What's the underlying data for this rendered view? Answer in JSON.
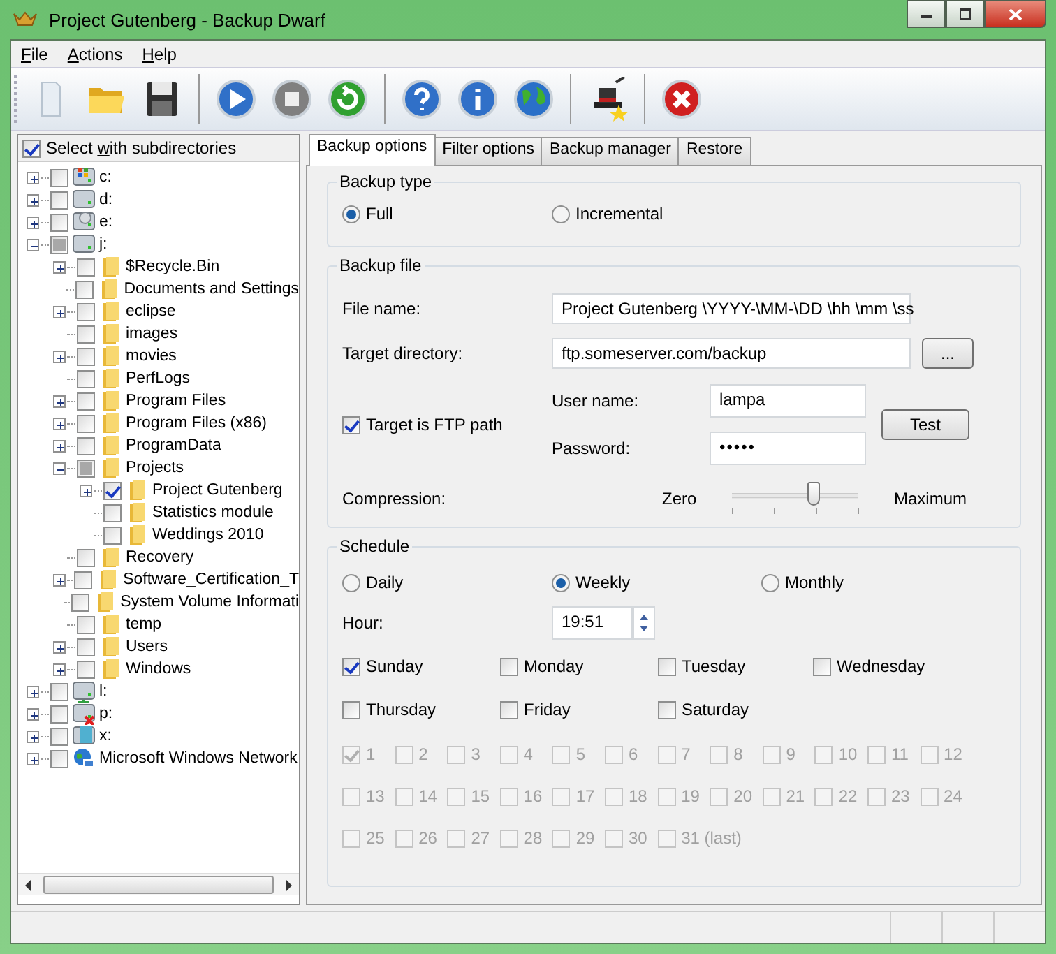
{
  "window": {
    "title": "Project Gutenberg - Backup Dwarf"
  },
  "menu": [
    {
      "label": "File"
    },
    {
      "label": "Actions"
    },
    {
      "label": "Help"
    }
  ],
  "tree": {
    "select_with_subdirectories": {
      "label": "Select with subdirectories",
      "checked": true
    },
    "items": [
      {
        "label": "c:",
        "kind": "windows-drive",
        "checked": false,
        "partial": false,
        "expanded": false
      },
      {
        "label": "d:",
        "kind": "drive",
        "checked": false,
        "partial": false,
        "expanded": false
      },
      {
        "label": "e:",
        "kind": "cd-drive",
        "checked": false,
        "partial": false,
        "expanded": false
      },
      {
        "label": "j:",
        "kind": "drive",
        "checked": false,
        "partial": true,
        "expanded": true,
        "children": [
          {
            "label": "$Recycle.Bin",
            "kind": "folder",
            "checked": false,
            "partial": false,
            "expanded": false
          },
          {
            "label": "Documents and Settings",
            "kind": "folder",
            "checked": false,
            "partial": false
          },
          {
            "label": "eclipse",
            "kind": "folder",
            "checked": false,
            "partial": false,
            "expanded": false
          },
          {
            "label": "images",
            "kind": "folder",
            "checked": false,
            "partial": false
          },
          {
            "label": "movies",
            "kind": "folder",
            "checked": false,
            "partial": false,
            "expanded": false
          },
          {
            "label": "PerfLogs",
            "kind": "folder",
            "checked": false,
            "partial": false
          },
          {
            "label": "Program Files",
            "kind": "folder",
            "checked": false,
            "partial": false,
            "expanded": false
          },
          {
            "label": "Program Files (x86)",
            "kind": "folder",
            "checked": false,
            "partial": false,
            "expanded": false
          },
          {
            "label": "ProgramData",
            "kind": "folder",
            "checked": false,
            "partial": false,
            "expanded": false
          },
          {
            "label": "Projects",
            "kind": "folder",
            "checked": false,
            "partial": true,
            "expanded": true,
            "children": [
              {
                "label": "Project Gutenberg",
                "kind": "folder",
                "checked": true,
                "partial": false,
                "expanded": false
              },
              {
                "label": "Statistics module",
                "kind": "folder",
                "checked": false,
                "partial": false
              },
              {
                "label": "Weddings 2010",
                "kind": "folder",
                "checked": false,
                "partial": false
              }
            ]
          },
          {
            "label": "Recovery",
            "kind": "folder",
            "checked": false,
            "partial": false
          },
          {
            "label": "Software_Certification_T",
            "kind": "folder",
            "checked": false,
            "partial": false,
            "expanded": false
          },
          {
            "label": "System Volume Informati",
            "kind": "folder",
            "checked": false,
            "partial": false
          },
          {
            "label": "temp",
            "kind": "folder",
            "checked": false,
            "partial": false
          },
          {
            "label": "Users",
            "kind": "folder",
            "checked": false,
            "partial": false,
            "expanded": false
          },
          {
            "label": "Windows",
            "kind": "folder",
            "checked": false,
            "partial": false,
            "expanded": false
          }
        ]
      },
      {
        "label": "l:",
        "kind": "network-drive",
        "checked": false,
        "partial": false,
        "expanded": false
      },
      {
        "label": "p:",
        "kind": "disconnected-drive",
        "checked": false,
        "partial": false,
        "expanded": false
      },
      {
        "label": "x:",
        "kind": "removable-drive",
        "checked": false,
        "partial": false,
        "expanded": false
      },
      {
        "label": "Microsoft Windows Network",
        "kind": "network",
        "checked": false,
        "partial": false,
        "expanded": false
      }
    ]
  },
  "tabs": [
    {
      "label": "Backup options",
      "selected": true
    },
    {
      "label": "Filter options",
      "selected": false
    },
    {
      "label": "Backup manager",
      "selected": false
    },
    {
      "label": "Restore",
      "selected": false
    }
  ],
  "backup_type": {
    "title": "Backup type",
    "options": [
      {
        "label": "Full",
        "selected": true
      },
      {
        "label": "Incremental",
        "selected": false
      }
    ]
  },
  "backup_file": {
    "title": "Backup file",
    "file_name": {
      "label": "File name:",
      "value": "Project Gutenberg \\YYYY-\\MM-\\DD \\hh \\mm \\ss"
    },
    "target_directory": {
      "label": "Target directory:",
      "value": "ftp.someserver.com/backup",
      "browse": "..."
    },
    "ftp": {
      "label": "Target is FTP path",
      "checked": true
    },
    "user_name": {
      "label": "User name:",
      "value": "lampa"
    },
    "password": {
      "label": "Password:",
      "value": "•••••"
    },
    "test": "Test",
    "compression": {
      "label": "Compression:",
      "min": "Zero",
      "max": "Maximum",
      "level": 0.66
    }
  },
  "schedule": {
    "title": "Schedule",
    "frequency": [
      {
        "label": "Daily",
        "selected": false
      },
      {
        "label": "Weekly",
        "selected": true
      },
      {
        "label": "Monthly",
        "selected": false
      }
    ],
    "hour": {
      "label": "Hour:",
      "value": "19:51"
    },
    "weekdays": [
      {
        "label": "Sunday",
        "checked": true
      },
      {
        "label": "Monday",
        "checked": false
      },
      {
        "label": "Tuesday",
        "checked": false
      },
      {
        "label": "Wednesday",
        "checked": false
      },
      {
        "label": "Thursday",
        "checked": false
      },
      {
        "label": "Friday",
        "checked": false
      },
      {
        "label": "Saturday",
        "checked": false
      }
    ],
    "month_days": {
      "disabled": true,
      "items": [
        {
          "label": "1",
          "checked": true
        },
        {
          "label": "2",
          "checked": false
        },
        {
          "label": "3",
          "checked": false
        },
        {
          "label": "4",
          "checked": false
        },
        {
          "label": "5",
          "checked": false
        },
        {
          "label": "6",
          "checked": false
        },
        {
          "label": "7",
          "checked": false
        },
        {
          "label": "8",
          "checked": false
        },
        {
          "label": "9",
          "checked": false
        },
        {
          "label": "10",
          "checked": false
        },
        {
          "label": "11",
          "checked": false
        },
        {
          "label": "12",
          "checked": false
        },
        {
          "label": "13",
          "checked": false
        },
        {
          "label": "14",
          "checked": false
        },
        {
          "label": "15",
          "checked": false
        },
        {
          "label": "16",
          "checked": false
        },
        {
          "label": "17",
          "checked": false
        },
        {
          "label": "18",
          "checked": false
        },
        {
          "label": "19",
          "checked": false
        },
        {
          "label": "20",
          "checked": false
        },
        {
          "label": "21",
          "checked": false
        },
        {
          "label": "22",
          "checked": false
        },
        {
          "label": "23",
          "checked": false
        },
        {
          "label": "24",
          "checked": false
        },
        {
          "label": "25",
          "checked": false
        },
        {
          "label": "26",
          "checked": false
        },
        {
          "label": "27",
          "checked": false
        },
        {
          "label": "28",
          "checked": false
        },
        {
          "label": "29",
          "checked": false
        },
        {
          "label": "30",
          "checked": false
        },
        {
          "label": "31 (last)",
          "checked": false
        }
      ]
    }
  }
}
